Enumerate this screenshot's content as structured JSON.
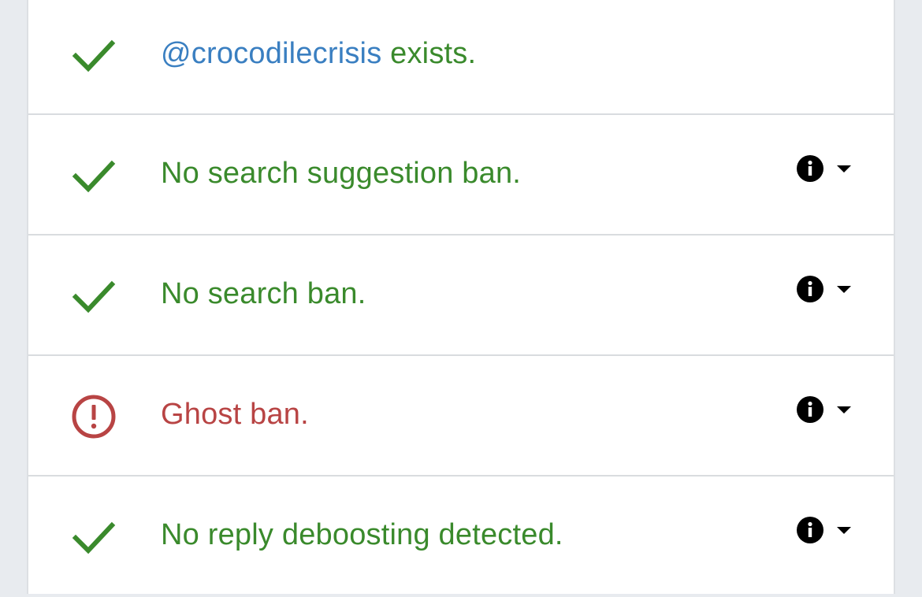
{
  "colors": {
    "ok": "#3a8a2c",
    "bad": "#b84444",
    "handle": "#3a7fc1",
    "icon": "#000000"
  },
  "results": [
    {
      "status": "ok",
      "icon": "check-icon",
      "handle": "@crocodilecrisis",
      "text": " exists.",
      "has_info": false
    },
    {
      "status": "ok",
      "icon": "check-icon",
      "text": "No search suggestion ban.",
      "has_info": true
    },
    {
      "status": "ok",
      "icon": "check-icon",
      "text": "No search ban.",
      "has_info": true
    },
    {
      "status": "bad",
      "icon": "alert-circle-icon",
      "text": "Ghost ban.",
      "has_info": true
    },
    {
      "status": "ok",
      "icon": "check-icon",
      "text": "No reply deboosting detected.",
      "has_info": true
    }
  ]
}
